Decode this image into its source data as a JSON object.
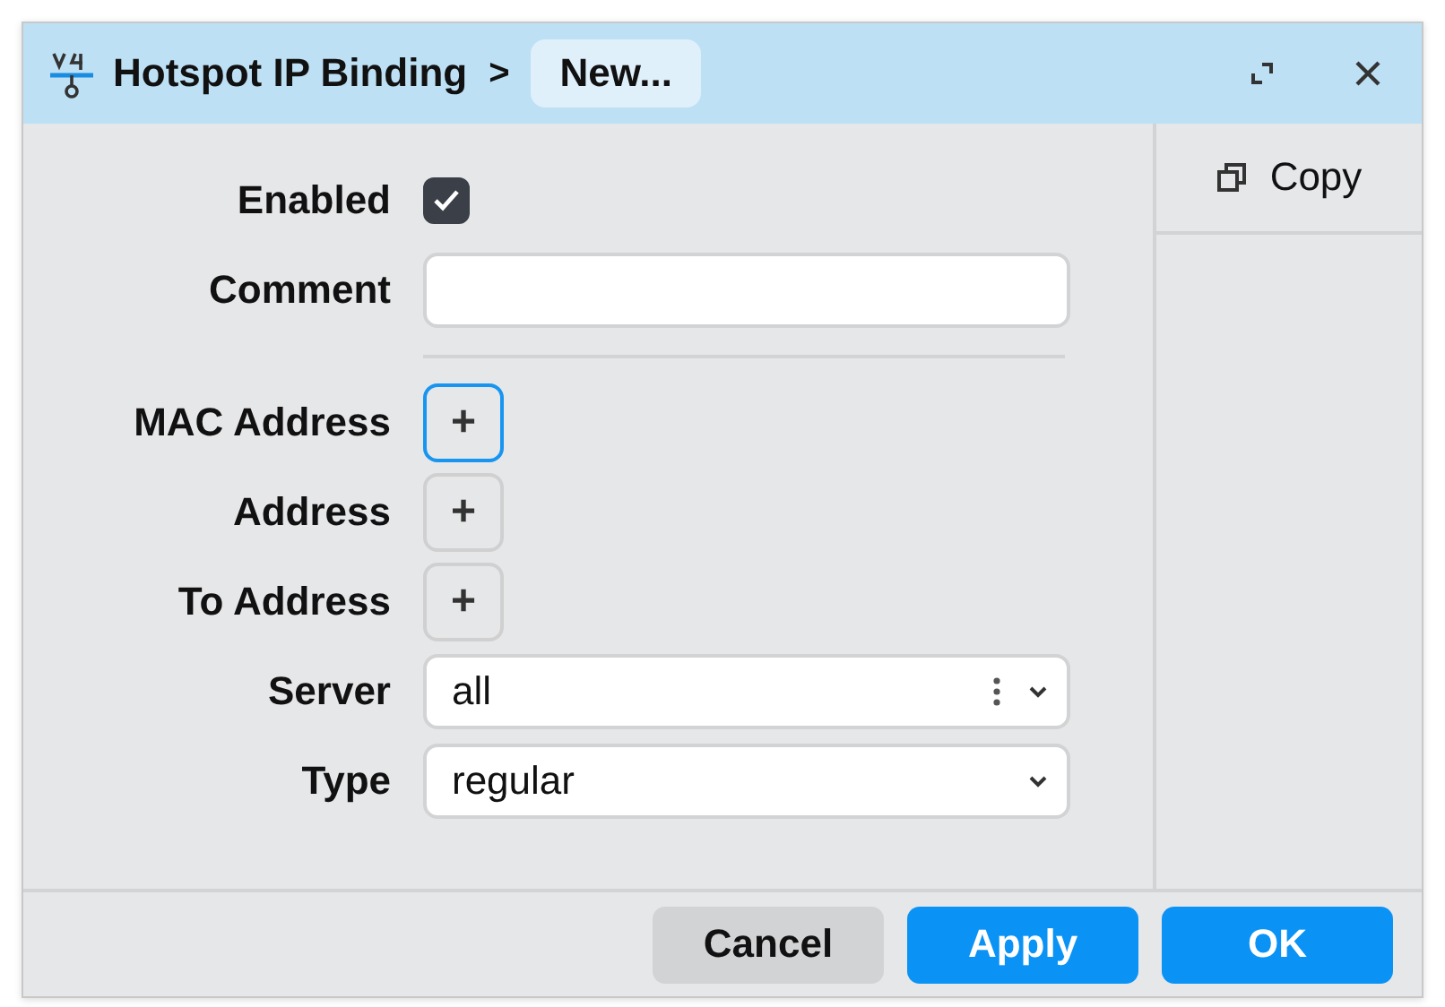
{
  "window": {
    "title": "Hotspot IP Binding",
    "separator": ">",
    "breadcrumb": "New..."
  },
  "fields": [
    {
      "kind": "checkbox",
      "label": "Enabled",
      "checked": true
    },
    {
      "kind": "text",
      "label": "Comment"
    },
    {
      "kind": "divider"
    },
    {
      "kind": "add",
      "label": "MAC Address",
      "icon": "+",
      "focused": true
    },
    {
      "kind": "add",
      "label": "Address",
      "icon": "+",
      "focused": false
    },
    {
      "kind": "add",
      "label": "To Address",
      "icon": "+",
      "focused": false
    },
    {
      "kind": "select",
      "label": "Server",
      "value": "all",
      "more": true
    },
    {
      "kind": "select",
      "label": "Type",
      "value": "regular",
      "more": false
    }
  ],
  "side_actions": [
    {
      "label": "Copy"
    }
  ],
  "buttons": [
    {
      "label": "Cancel",
      "kind": "secondary"
    },
    {
      "label": "Apply",
      "kind": "primary"
    },
    {
      "label": "OK",
      "kind": "primary"
    }
  ]
}
